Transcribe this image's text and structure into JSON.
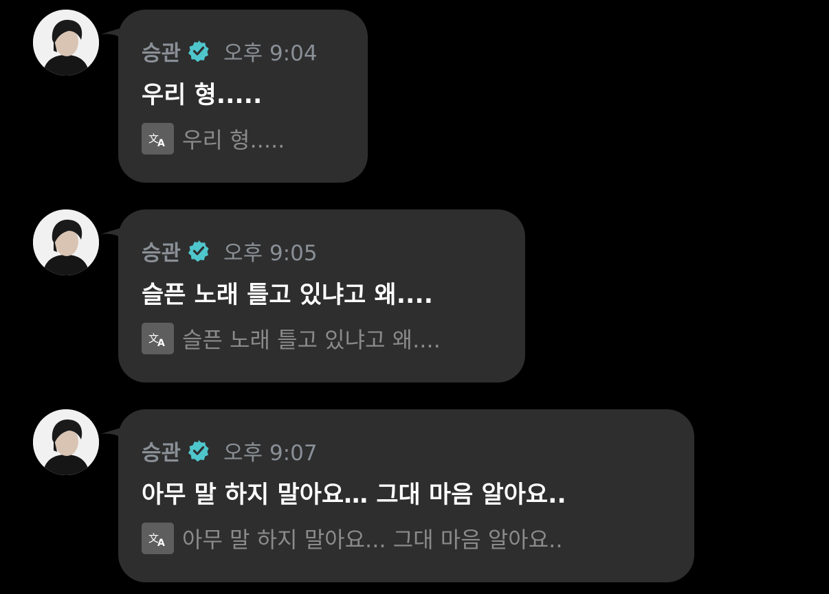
{
  "colors": {
    "background": "#000000",
    "bubble": "#2e2e2e",
    "sender": "#8a9097",
    "verified_badge": "#4fc6cc",
    "message_text": "#ffffff",
    "translation_text": "#8b8b8b",
    "translate_icon_bg": "#5e5e5e"
  },
  "icons": {
    "verified": "verified-badge-icon",
    "translate": "translate-icon",
    "avatar": "avatar"
  },
  "messages": [
    {
      "sender": "승관",
      "time": "오후 9:04",
      "text": "우리 형.....",
      "translation": "우리 형....."
    },
    {
      "sender": "승관",
      "time": "오후 9:05",
      "text": "슬픈 노래 틀고 있냐고 왜....",
      "translation": "슬픈 노래 틀고 있냐고 왜...."
    },
    {
      "sender": "승관",
      "time": "오후 9:07",
      "text": "아무 말 하지 말아요… 그대 마음 알아요..",
      "translation": "아무 말 하지 말아요... 그대 마음 알아요.."
    }
  ]
}
